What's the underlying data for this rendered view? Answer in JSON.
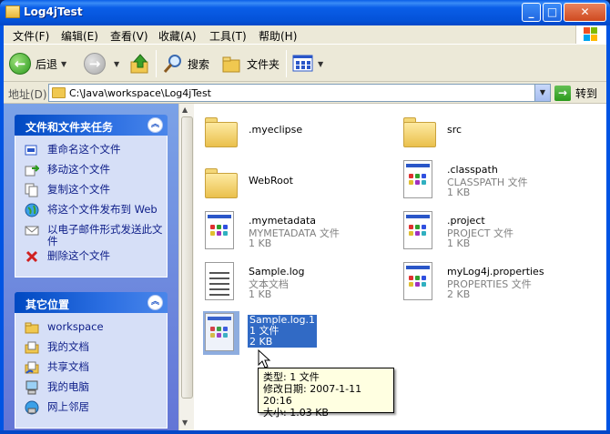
{
  "window": {
    "title": "Log4jTest"
  },
  "menu": [
    "文件(F)",
    "编辑(E)",
    "查看(V)",
    "收藏(A)",
    "工具(T)",
    "帮助(H)"
  ],
  "toolbar": {
    "back": "后退",
    "search": "搜索",
    "folders": "文件夹"
  },
  "address": {
    "label": "地址(D)",
    "path": "C:\\Java\\workspace\\Log4jTest",
    "go": "转到"
  },
  "tasks_panel": {
    "title": "文件和文件夹任务",
    "items": [
      "重命名这个文件",
      "移动这个文件",
      "复制这个文件",
      "将这个文件发布到 Web",
      "以电子邮件形式发送此文件",
      "删除这个文件"
    ]
  },
  "places_panel": {
    "title": "其它位置",
    "items": [
      "workspace",
      "我的文档",
      "共享文档",
      "我的电脑",
      "网上邻居"
    ]
  },
  "files": [
    {
      "name": ".myeclipse",
      "kind": "folder"
    },
    {
      "name": "src",
      "kind": "folder"
    },
    {
      "name": "WebRoot",
      "kind": "folder"
    },
    {
      "name": ".classpath",
      "type": "CLASSPATH 文件",
      "size": "1 KB",
      "kind": "doc"
    },
    {
      "name": ".mymetadata",
      "type": "MYMETADATA 文件",
      "size": "1 KB",
      "kind": "doc"
    },
    {
      "name": ".project",
      "type": "PROJECT 文件",
      "size": "1 KB",
      "kind": "doc"
    },
    {
      "name": "Sample.log",
      "type": "文本文档",
      "size": "1 KB",
      "kind": "text"
    },
    {
      "name": "myLog4j.properties",
      "type": "PROPERTIES 文件",
      "size": "2 KB",
      "kind": "doc"
    },
    {
      "name": "Sample.log.1",
      "type": "1 文件",
      "size": "2 KB",
      "kind": "doc",
      "selected": true
    }
  ],
  "tooltip": {
    "line1": "类型: 1 文件",
    "line2": "修改日期: 2007-1-11 20:16",
    "line3": "大小: 1.03 KB"
  },
  "colors": {
    "title_bar": "#0054e3",
    "task_pane": "#7ba2e7",
    "selection": "#316ac5",
    "tooltip_bg": "#ffffe1"
  },
  "icons": [
    "back-icon",
    "forward-icon",
    "up-folder-icon",
    "search-icon",
    "folders-icon",
    "views-icon",
    "go-icon"
  ]
}
